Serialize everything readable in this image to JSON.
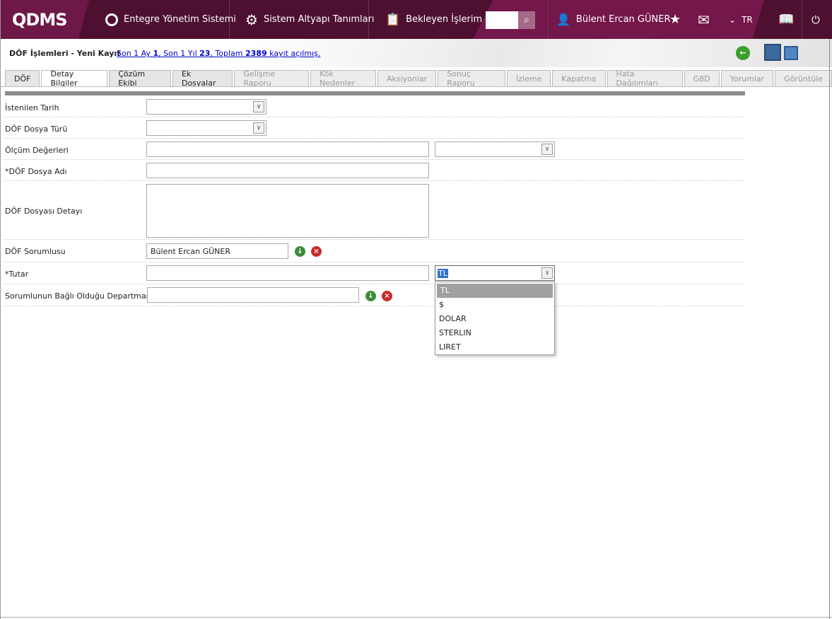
{
  "header": {
    "logo": "QDMS",
    "nav": [
      {
        "label": "Entegre Yönetim Sistemi",
        "icon": "q-icon"
      },
      {
        "label": "Sistem Altyapı Tanımları",
        "icon": "gear-icon"
      },
      {
        "label": "Bekleyen İşlerim",
        "icon": "clipboard-icon"
      }
    ],
    "search_value": "",
    "user": "Bülent Ercan GÜNER",
    "language": "TR"
  },
  "subheader": {
    "title": "DÖF İşlemleri - Yeni Kayıt",
    "stats": {
      "p1": "Son 1 Ay ",
      "v1": "1",
      "p2": ", Son 1 Yıl ",
      "v2": "23",
      "p3": ", Toplam ",
      "v3": "2389",
      "p4": " kayıt açılmış."
    }
  },
  "tabs": [
    {
      "label": "DÖF"
    },
    {
      "label": "Detay Bilgiler"
    },
    {
      "label": "Çözüm Ekibi"
    },
    {
      "label": "Ek Dosyalar"
    },
    {
      "label": "Gelişme Raporu"
    },
    {
      "label": "Kök Nedenler"
    },
    {
      "label": "Aksiyonlar"
    },
    {
      "label": "Sonuç Raporu"
    },
    {
      "label": "İzleme"
    },
    {
      "label": "Kapatma"
    },
    {
      "label": "Hata Dağılımları"
    },
    {
      "label": "G8D"
    },
    {
      "label": "Yorumlar"
    },
    {
      "label": "Görüntüle"
    }
  ],
  "form": {
    "istenilen_tarih": "İstenilen Tarih",
    "dosya_turu": "DÖF Dosya Türü",
    "olcum": "Ölçüm Değerleri",
    "dosya_adi": "*DÖF Dosya Adı",
    "dosya_detayi": "DÖF Dosyası Detayı",
    "sorumlu": "DÖF Sorumlusu",
    "sorumlu_value": "Bülent Ercan GÜNER",
    "tutar": "*Tutar",
    "currency_value": "TL",
    "departman": "Sorumlunun Bağlı Olduğu Departman"
  },
  "currency_options": [
    "TL",
    "$",
    "DOLAR",
    "STERLIN",
    "LIRET"
  ]
}
